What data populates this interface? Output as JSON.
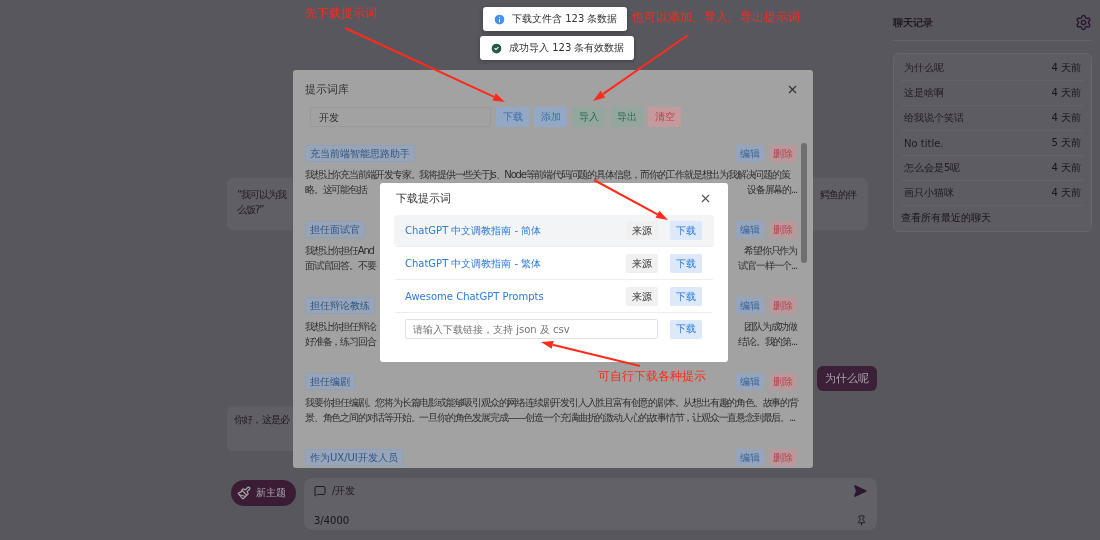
{
  "annotations": [
    {
      "text": "先下载提示词"
    },
    {
      "text": "也可以添加、导入、导出提示词"
    },
    {
      "text": "可自行下载各种提示"
    }
  ],
  "toasts": [
    {
      "kind": "info",
      "text": "下载文件含 123 条数据"
    },
    {
      "kind": "success",
      "text": "成功导入 123 条有效数据"
    }
  ],
  "chat": {
    "messages": [
      {
        "kind": "split",
        "left_lines": [
          "“我可以为我",
          "么饭?”"
        ],
        "right_lines": [
          "鳄鱼的伴"
        ]
      },
      {
        "kind": "user",
        "text": "为什么呢"
      },
      {
        "kind": "bot",
        "text": "你好，这是必"
      }
    ],
    "new_topic": "新主题",
    "input": {
      "value": "/开发",
      "counter": "3/4000"
    }
  },
  "sidebar": {
    "title": "聊天记录",
    "items": [
      {
        "title": "为什么呢",
        "time": "4 天前"
      },
      {
        "title": "这是啥啊",
        "time": "4 天前"
      },
      {
        "title": "给我说个笑话",
        "time": "4 天前"
      },
      {
        "title": "No title.",
        "time": "5 天前"
      },
      {
        "title": "怎么会是5呢",
        "time": "4 天前"
      },
      {
        "title": "画只小猫咪",
        "time": "4 天前"
      }
    ],
    "footer": "查看所有最近的聊天"
  },
  "prompt_library": {
    "title": "提示词库",
    "search": {
      "value": "开发"
    },
    "buttons": [
      {
        "label": "下载",
        "kind": "primary"
      },
      {
        "label": "添加",
        "kind": "primary"
      },
      {
        "label": "导入",
        "kind": "success"
      },
      {
        "label": "导出",
        "kind": "success"
      },
      {
        "label": "清空",
        "kind": "danger"
      }
    ],
    "items": [
      {
        "name": "充当前端智能思路助手",
        "edit": "编辑",
        "delete": "删除",
        "lines": [
          {
            "kind": "full",
            "text": "我想让你充当前端开发专家。我将提供一些关于Js、Node等前端代码问题的具体信息，而你的工作就是想出为我解决问题的策"
          },
          {
            "kind": "split",
            "left": "略。这可能包括",
            "right": "设备屏幕的..."
          }
        ]
      },
      {
        "name": "担任面试官",
        "edit": "编辑",
        "delete": "删除",
        "lines": [
          {
            "kind": "split",
            "left": "我想让你担任And",
            "right": "希望你只作为"
          },
          {
            "kind": "split",
            "left": "面试官回答。不要",
            "right": "试官一样一个..."
          }
        ]
      },
      {
        "name": "担任辩论教练",
        "edit": "编辑",
        "delete": "删除",
        "lines": [
          {
            "kind": "split",
            "left": "我想让你担任辩论",
            "right": "团队为成功做"
          },
          {
            "kind": "split",
            "left": "好准备，练习回合",
            "right": "结论。我的第..."
          }
        ]
      },
      {
        "name": "担任编剧",
        "edit": "编辑",
        "delete": "删除",
        "lines": [
          {
            "kind": "full",
            "text": "我要你担任编剧。您将为长篇电影或能够吸引观众的网络连续剧开发引人入胜且富有创意的剧本。从想出有趣的角色、故事的背"
          },
          {
            "kind": "full",
            "text": "景、角色之间的对话等开始。一旦你的角色发展完成——创造一个充满曲折的激动人心的故事情节，让观众一直悬念到最后。..."
          }
        ]
      },
      {
        "name": "作为UX/UI开发人员",
        "edit": "编辑",
        "delete": "删除"
      }
    ]
  },
  "download_dialog": {
    "title": "下载提示词",
    "sources": [
      {
        "name": "ChatGPT 中文调教指南 - 简体",
        "source": "来源",
        "download": "下载",
        "hovered": true
      },
      {
        "name": "ChatGPT 中文调教指南 - 繁体",
        "source": "来源",
        "download": "下载",
        "hovered": false
      },
      {
        "name": "Awesome ChatGPT Prompts",
        "source": "来源",
        "download": "下载",
        "hovered": false
      }
    ],
    "url_input": {
      "placeholder": "请输入下载链接，支持 json 及 csv"
    },
    "download": "下载"
  }
}
